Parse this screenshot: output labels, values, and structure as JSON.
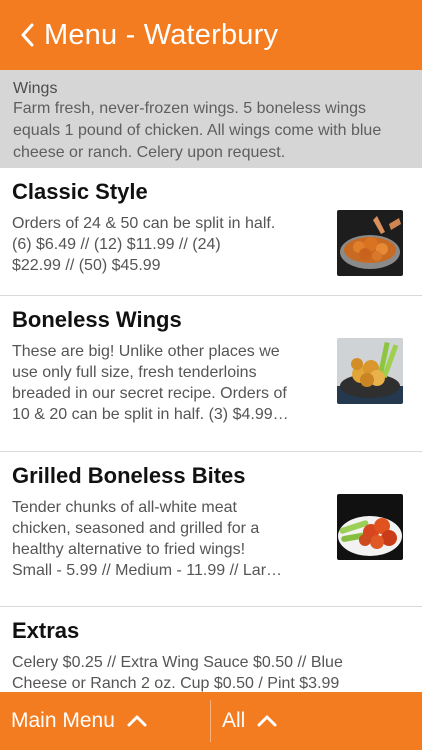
{
  "header": {
    "title": "Menu - Waterbury",
    "back_icon": "chevron-left-icon"
  },
  "category": {
    "title": "Wings",
    "description": "Farm fresh, never-frozen wings. 5 boneless wings equals 1 pound of chicken. All wings come with blue cheese or ranch. Celery upon request."
  },
  "items": [
    {
      "name": "Classic Style",
      "description": "Orders of 24 & 50 can be split in half.\n(6) $6.49 // (12) $11.99 // (24)\n$22.99 // (50) $45.99",
      "image": "classic-wings-photo"
    },
    {
      "name": "Boneless Wings",
      "description": "These are big! Unlike other places we\nuse only full size, fresh tenderloins\nbreaded in our secret recipe. Orders of\n10 & 20 can be split in half. (3) $4.99…",
      "image": "boneless-wings-photo"
    },
    {
      "name": "Grilled Boneless Bites",
      "description": "Tender chunks of all-white meat\nchicken, seasoned and grilled for a\nhealthy alternative to fried wings!\nSmall - 5.99 // Medium - 11.99 // Lar…",
      "image": "grilled-bites-photo"
    },
    {
      "name": "Extras",
      "description": "Celery $0.25 // Extra Wing Sauce $0.50 // Blue\nCheese or Ranch 2 oz. Cup $0.50 / Pint $3.99"
    }
  ],
  "footer": {
    "main_menu_label": "Main Menu",
    "all_label": "All",
    "icon": "chevron-up-icon"
  },
  "colors": {
    "accent": "#f47c20",
    "banner_bg": "#d6d6d6"
  }
}
